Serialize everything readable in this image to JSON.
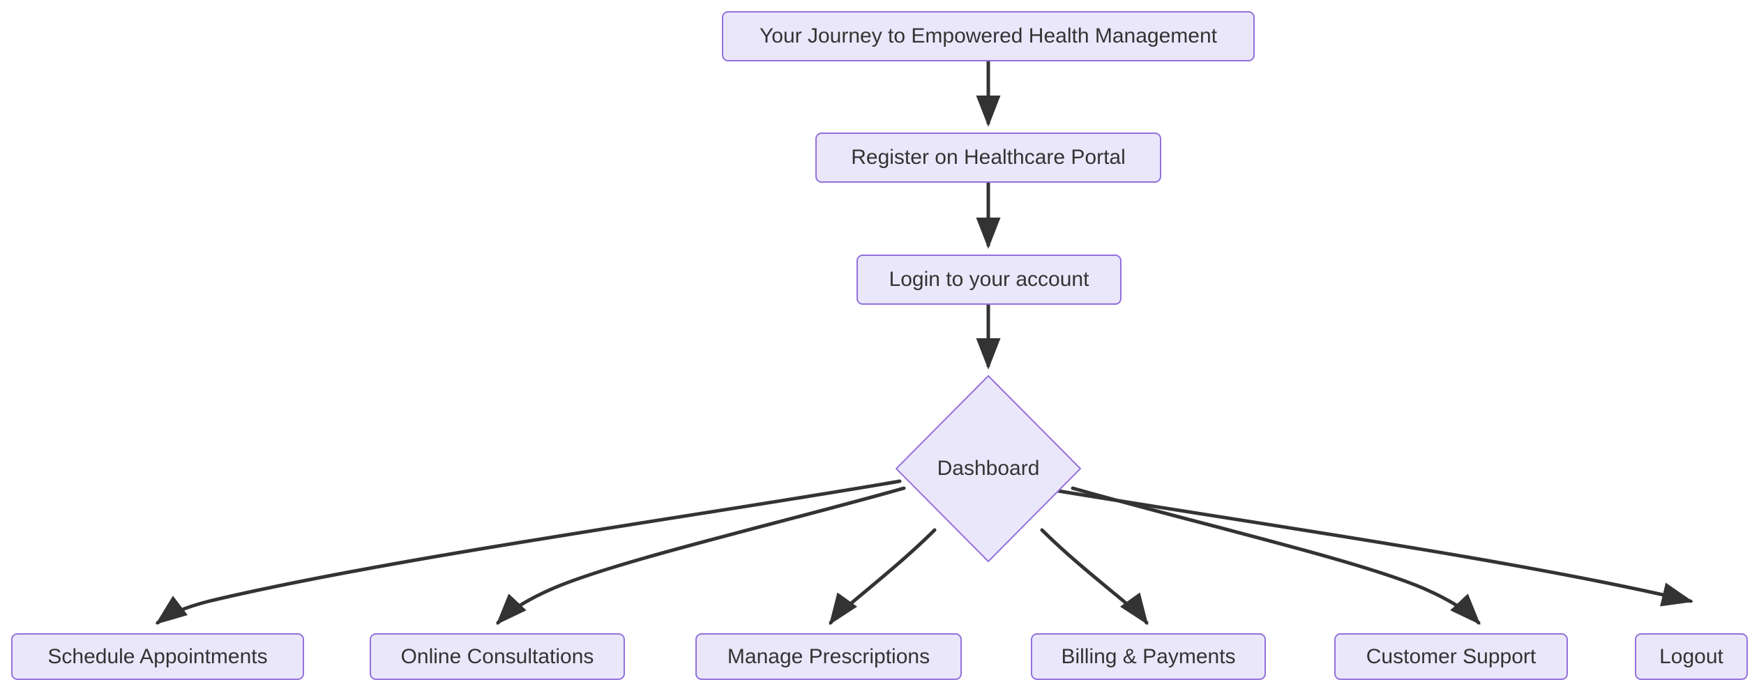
{
  "diagram": {
    "title": "Your Journey to Empowered Health Management",
    "type": "flowchart",
    "direction": "top-down",
    "background_color": "#ffffff",
    "node_fill_color": "#ebe7fb",
    "node_border_color": "#9370db",
    "node_text_color": "#333333",
    "edge_color": "#333333"
  },
  "nodes": {
    "title": {
      "label": "Your Journey to Empowered Health Management",
      "shape": "rounded-rect"
    },
    "register": {
      "label": "Register on Healthcare Portal",
      "shape": "rounded-rect"
    },
    "login": {
      "label": "Login to your account",
      "shape": "rounded-rect"
    },
    "dashboard": {
      "label": "Dashboard",
      "shape": "diamond"
    },
    "leaf": [
      {
        "label": "Schedule Appointments",
        "shape": "rounded-rect"
      },
      {
        "label": "Online Consultations",
        "shape": "rounded-rect"
      },
      {
        "label": "Manage Prescriptions",
        "shape": "rounded-rect"
      },
      {
        "label": "Billing & Payments",
        "shape": "rounded-rect"
      },
      {
        "label": "Customer Support",
        "shape": "rounded-rect"
      },
      {
        "label": "Logout",
        "shape": "rounded-rect"
      }
    ]
  },
  "edges": [
    {
      "from": "Your Journey to Empowered Health Management",
      "to": "Register on Healthcare Portal",
      "style": "straight-arrow"
    },
    {
      "from": "Register on Healthcare Portal",
      "to": "Login to your account",
      "style": "straight-arrow"
    },
    {
      "from": "Login to your account",
      "to": "Dashboard",
      "style": "straight-arrow"
    },
    {
      "from": "Dashboard",
      "to": "Schedule Appointments",
      "style": "curved-arrow"
    },
    {
      "from": "Dashboard",
      "to": "Online Consultations",
      "style": "curved-arrow"
    },
    {
      "from": "Dashboard",
      "to": "Manage Prescriptions",
      "style": "curved-arrow"
    },
    {
      "from": "Dashboard",
      "to": "Billing & Payments",
      "style": "curved-arrow"
    },
    {
      "from": "Dashboard",
      "to": "Customer Support",
      "style": "curved-arrow"
    },
    {
      "from": "Dashboard",
      "to": "Logout",
      "style": "curved-arrow"
    }
  ]
}
